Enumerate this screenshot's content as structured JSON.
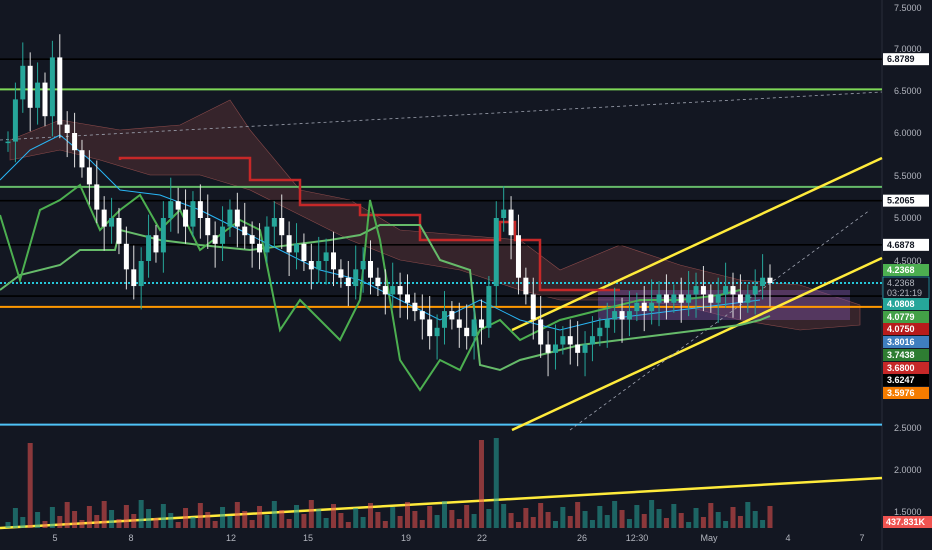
{
  "chart_data": {
    "type": "candlestick",
    "price_axis": {
      "ticks": [
        "7.5000",
        "7.0000",
        "6.5000",
        "6.0000",
        "5.5000",
        "5.0000",
        "4.5000",
        "2.5000",
        "2.0000",
        "1.5000"
      ]
    },
    "time_axis": {
      "ticks": [
        "5",
        "8",
        "12",
        "15",
        "19",
        "22",
        "26",
        "12:30",
        "May",
        "4",
        "7"
      ]
    },
    "horizontal_levels": [
      {
        "value": 6.8789,
        "label": "6.8789",
        "color": "#000000"
      },
      {
        "value": 6.52,
        "label": "",
        "color": "#7ed957"
      },
      {
        "value": 5.37,
        "label": "",
        "color": "#66bb6a"
      },
      {
        "value": 5.2065,
        "label": "5.2065",
        "color": "#000000"
      },
      {
        "value": 4.6878,
        "label": "4.6878",
        "color": "#000000"
      },
      {
        "value": 4.08,
        "label": "",
        "color": "#000000"
      },
      {
        "value": 4.2368,
        "label": "",
        "color": "#26c6da"
      },
      {
        "value": 3.95,
        "label": "",
        "color": "#ff9800"
      },
      {
        "value": 2.54,
        "label": "",
        "color": "#4fc3f7"
      }
    ],
    "price_badges": [
      {
        "label": "4.2368",
        "color": "#4caf50"
      },
      {
        "label": "4.2368",
        "color": "#131722",
        "sub": "03:21:19"
      },
      {
        "label": "4.0808",
        "color": "#26a69a"
      },
      {
        "label": "4.0779",
        "color": "#43a047"
      },
      {
        "label": "4.0750",
        "color": "#b71c1c"
      },
      {
        "label": "3.8016",
        "color": "#3f7fbf"
      },
      {
        "label": "3.7438",
        "color": "#2e7d32"
      },
      {
        "label": "3.6800",
        "color": "#c62828"
      },
      {
        "label": "3.6247",
        "color": "#000000"
      },
      {
        "label": "3.5976",
        "color": "#f57c00"
      }
    ],
    "volume_badge": {
      "label": "437.831K",
      "color": "#ef5350"
    },
    "closes": [
      5.9,
      6.4,
      6.8,
      6.3,
      6.6,
      6.2,
      6.9,
      6.1,
      6.0,
      5.8,
      5.6,
      5.4,
      5.1,
      4.9,
      5.0,
      4.7,
      4.4,
      4.2,
      4.5,
      4.8,
      4.6,
      5.0,
      5.2,
      5.1,
      4.9,
      5.2,
      5.0,
      4.8,
      4.7,
      4.9,
      5.1,
      4.9,
      4.8,
      4.7,
      4.6,
      4.9,
      5.0,
      4.8,
      4.6,
      4.7,
      4.5,
      4.4,
      4.5,
      4.6,
      4.4,
      4.3,
      4.2,
      4.4,
      4.5,
      4.3,
      4.2,
      4.1,
      4.2,
      4.1,
      4.0,
      3.9,
      3.8,
      3.6,
      3.7,
      3.9,
      3.8,
      3.7,
      3.6,
      3.8,
      3.7,
      4.2,
      5.0,
      5.1,
      4.8,
      4.3,
      4.1,
      3.8,
      3.5,
      3.4,
      3.5,
      3.6,
      3.5,
      3.4,
      3.5,
      3.6,
      3.7,
      3.8,
      3.9,
      3.8,
      3.9,
      4.0,
      3.9,
      4.0,
      4.1,
      4.0,
      4.1,
      4.0,
      4.1,
      4.2,
      4.1,
      4.0,
      4.1,
      4.2,
      4.1,
      4.0,
      4.1,
      4.2,
      4.3,
      4.2368
    ]
  }
}
